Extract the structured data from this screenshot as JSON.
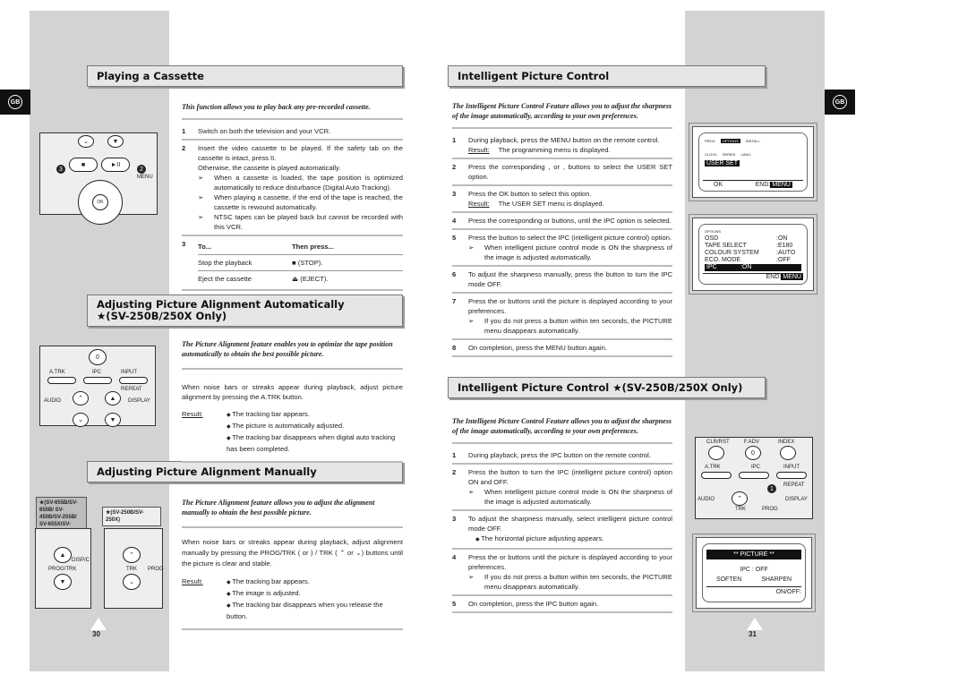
{
  "tabs": {
    "left": "GB",
    "right": "GB"
  },
  "page_numbers": {
    "left": "30",
    "right": "31"
  },
  "playing": {
    "title": "Playing a Cassette",
    "intro": "This function allows you to play back any pre-recorded cassette.",
    "steps": [
      {
        "n": "1",
        "text": "Switch on both the television and your VCR."
      },
      {
        "n": "2",
        "text": "Insert the video cassette to be played. If the safety tab on the cassette is intact, press  II.",
        "extra": "Otherwise, the cassette is played automatically.",
        "notes": [
          "When a cassette is loaded, the tape position is optimized automatically to reduce disturbance (Digital Auto Tracking).",
          "When playing a cassette, if the end of the tape is reached, the cassette is rewound automatically.",
          "NTSC tapes can be played back but cannot be recorded with this VCR."
        ]
      }
    ],
    "step3": {
      "n": "3",
      "col1": "To...",
      "col2": "Then press...",
      "rows": [
        [
          "Stop the playback",
          "■ (STOP)."
        ],
        [
          "Eject the cassette",
          "⏏ (EJECT)."
        ]
      ]
    }
  },
  "auto": {
    "title": "Adjusting Picture Alignment Automatically",
    "subtitle": "★(SV-250B/250X Only)",
    "intro": "The Picture Alignment feature enables you to optimize the tape position automatically to obtain the best possible picture.",
    "text": "When noise bars or streaks appear during playback, adjust picture alignment by pressing the A.TRK button.",
    "result_label": "Result:",
    "results": [
      "The tracking bar appears.",
      "The picture is automatically adjusted.",
      "The tracking bar disappears when digital auto tracking has been completed."
    ]
  },
  "manual": {
    "title": "Adjusting Picture Alignment Manually",
    "intro": "The Picture Alignment feature allows you to adjust the alignment manually to obtain the best possible picture.",
    "text": "When noise bars or streaks appear during playback, adjust alignment manually by pressing the PROG/TRK (    or    ) / TRK ( ⌃ or ⌄) buttons until the picture is clear and stable.",
    "result_label": "Result:",
    "results": [
      "The tracking bar appears.",
      "The image is adjusted.",
      "The tracking bar disappears when you release the button."
    ],
    "models_a": "★(SV-655B/SV-650B/ SV-450B/SV-255B/ SV-655X/SV-450X/ SV-650X)",
    "models_b": "★(SV-250B/SV-250X)"
  },
  "ipc": {
    "title": "Intelligent Picture Control",
    "intro": "The Intelligent Picture Control Feature allows you to adjust the sharpness of the image automatically, according to your own preferences.",
    "steps": [
      {
        "n": "1",
        "text": "During playback, press the MENU button on the remote control.",
        "result": "The programming menu is displayed."
      },
      {
        "n": "2",
        "text": "Press the corresponding    ,   or   ,   buttons to select the USER SET option."
      },
      {
        "n": "3",
        "text": "Press the OK button to select this option.",
        "result": "The USER SET menu is displayed."
      },
      {
        "n": "4",
        "text": "Press the corresponding     or     buttons, until the IPC option is selected."
      },
      {
        "n": "5",
        "text": "Press the    button to select the IPC (intelligent picture control) option.",
        "notes": [
          "When intelligent picture control mode is ON the sharpness of the image is adjusted automatically."
        ]
      },
      {
        "n": "6",
        "text": "To adjust the sharpness manually, press the     button to turn the IPC mode OFF."
      },
      {
        "n": "7",
        "text": "Press the    or    buttons until the picture is displayed according to your preferences.",
        "notes": [
          "If you do not press a button within ten seconds, the PICTURE menu disappears automatically."
        ]
      },
      {
        "n": "8",
        "text": "On completion, press the MENU button again."
      }
    ]
  },
  "ipc2": {
    "title": "Intelligent Picture Control ★(SV-250B/250X Only)",
    "intro": "The Intelligent Picture Control Feature allows you to adjust the sharpness of the image automatically, according to your own preferences.",
    "steps": [
      {
        "n": "1",
        "text": "During playback, press the IPC button on the remote control."
      },
      {
        "n": "2",
        "text": "Press the    button to turn the IPC (intelligent picture control) option ON and OFF.",
        "notes": [
          "When intelligent picture control mode is ON the sharpness of the image is adjusted automatically."
        ]
      },
      {
        "n": "3",
        "text": "To adjust the sharpness manually, select intelligent picture control mode OFF.",
        "bullets": [
          "The horizontal picture adjusting appears."
        ]
      },
      {
        "n": "4",
        "text": "Press the    or    buttons until the picture is displayed according to your preferences.",
        "notes": [
          "If you do not press a button within ten seconds, the PICTURE menu disappears automatically."
        ]
      },
      {
        "n": "5",
        "text": "On completion, press the IPC button again."
      }
    ]
  },
  "result_label": "Result:",
  "osd_menu": {
    "icons": [
      "PROG",
      "OPTIONS",
      "INSTALL",
      "CLOCK",
      "SERIES",
      "LANG."
    ],
    "selected": "USER SET",
    "ok": "OK",
    "end": "END:",
    "menu": "MENU"
  },
  "osd_options": {
    "icon": "OPTIONS",
    "rows": [
      [
        "OSD",
        ":ON"
      ],
      [
        "TAPE SELECT",
        ":E180"
      ],
      [
        "COLOUR SYSTEM",
        ":AUTO"
      ],
      [
        "ECO. MODE",
        ":OFF"
      ]
    ],
    "selected": [
      "IPC",
      ":ON"
    ],
    "end": "END:",
    "menu": "MENU"
  },
  "osd_picture": {
    "title": "**   PICTURE   **",
    "ipc": "IPC  :  OFF",
    "soften": "SOFTEN",
    "sharpen": "SHARPEN",
    "onoff": "ON/OFF:"
  },
  "remote_labels": {
    "clrrst": "CLR/RST",
    "fadv": "F.ADV",
    "index": "INDEX",
    "zero": "0",
    "atrk": "A.TRK",
    "ipc": "IPC",
    "input": "INPUT",
    "repeat": "REPEAT",
    "audio": "AUDIO",
    "display": "DISPLAY",
    "trk": "TRK",
    "prog": "PROG",
    "menu": "MENU",
    "progtrk": "PROG/TRK",
    "disp": "DISP/C"
  }
}
